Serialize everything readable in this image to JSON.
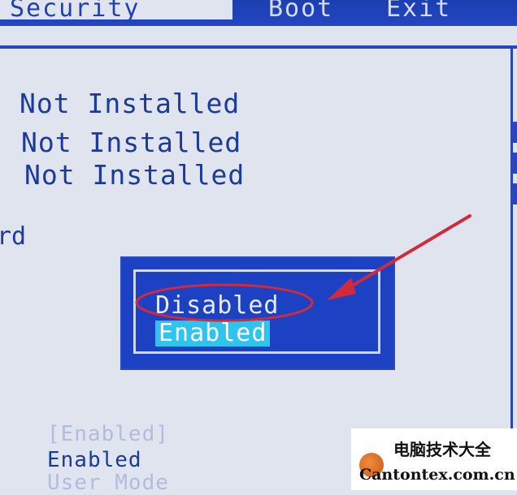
{
  "menu": {
    "active_tab": "Security",
    "tabs": [
      "Boot",
      "Exit"
    ]
  },
  "values": [
    "Not Installed",
    "Not Installed",
    "Not Installed"
  ],
  "left_fragment": "rd",
  "popup": {
    "options": [
      "Disabled",
      "Enabled"
    ],
    "highlighted": "Enabled"
  },
  "bottom": {
    "bracket_value": "[Enabled]",
    "value": "Enabled",
    "mode": "User Mode"
  },
  "watermark": {
    "cn": "电脑技术大全",
    "site": "Cantontex.com.cn"
  },
  "annotation_colors": {
    "circle": "#d02a3c",
    "arrow": "#d02a3c"
  }
}
